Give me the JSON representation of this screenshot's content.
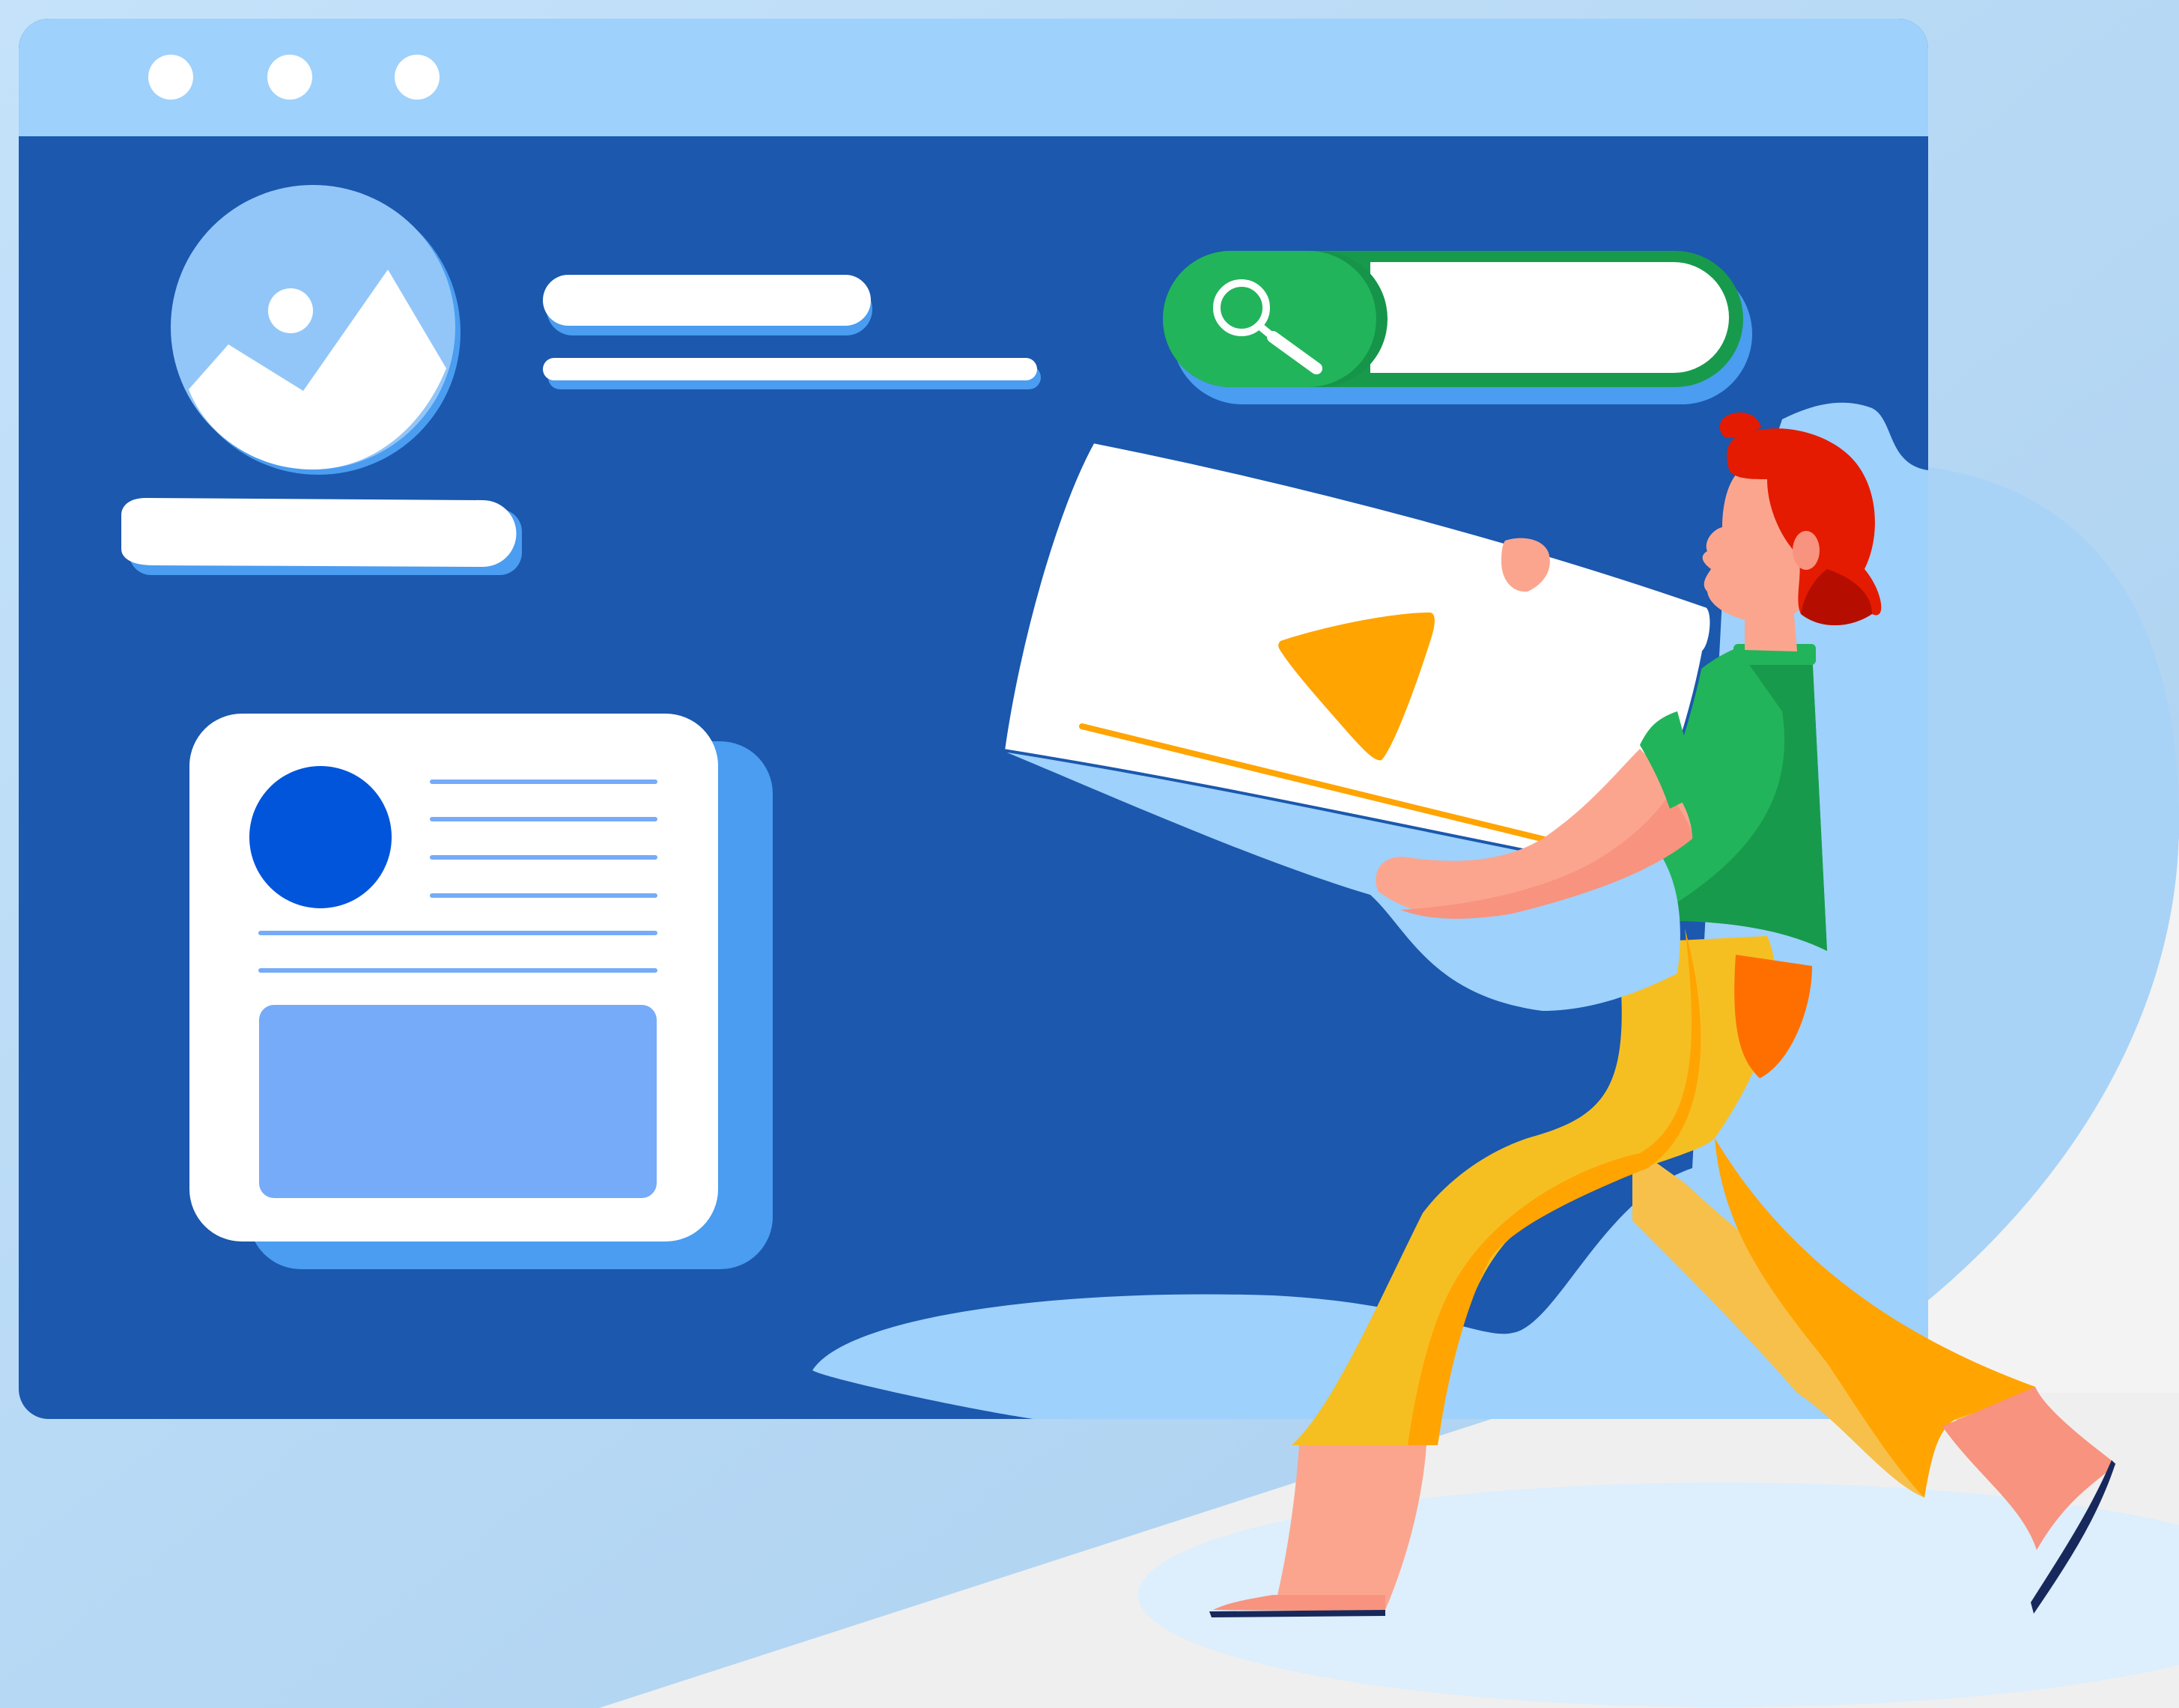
{
  "colors": {
    "background_light": "#BBDCF6",
    "window_titlebar": "#9ED1FB",
    "window_body": "#1B58AE",
    "panel_blue": "#4A9DF1",
    "image_placeholder": "#93C6F8",
    "search_green": "#22B45A",
    "search_green_dark": "#159148",
    "card_avatar": "#0055DB",
    "card_media": "#75ABF9",
    "card_lines": "#75ABF9",
    "play_orange": "#FFA400",
    "hair_red": "#E41B00",
    "shirt_green": "#22B45A",
    "pants_yellow": "#F5BF22",
    "skin": "#FBA58F"
  },
  "window": {
    "controls": [
      "close-dot",
      "minimize-dot",
      "maximize-dot"
    ]
  },
  "icons": {
    "image": "image-placeholder-icon",
    "search": "search-icon",
    "play": "play-icon"
  },
  "illustration": {
    "figure": "person-carrying-video-player",
    "held_item": "video-player-card"
  }
}
